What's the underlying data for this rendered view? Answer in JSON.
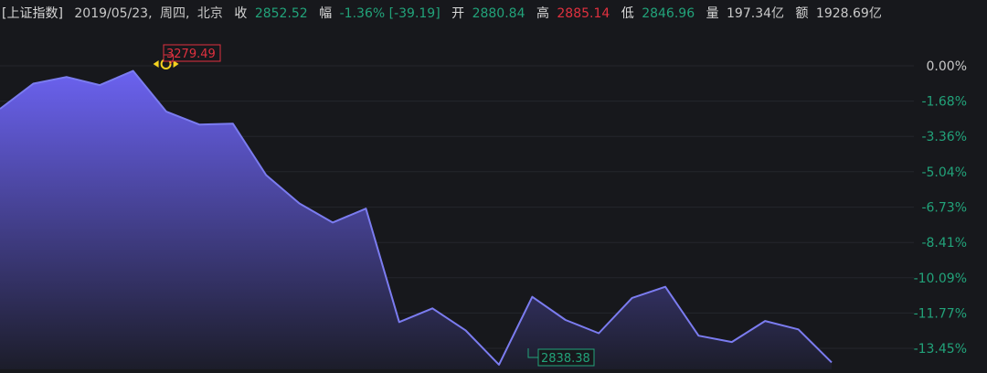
{
  "header": {
    "index_name": "[上证指数]",
    "date": "2019/05/23,",
    "weekday": "周四,",
    "region": "北京",
    "close_label": "收",
    "close_value": "2852.52",
    "change_label": "幅",
    "change_pct": "-1.36%",
    "change_abs": "[-39.19]",
    "open_label": "开",
    "open_value": "2880.84",
    "high_label": "高",
    "high_value": "2885.14",
    "low_label": "低",
    "low_value": "2846.96",
    "volume_label": "量",
    "volume_value": "197.34亿",
    "amount_label": "额",
    "amount_value": "1928.69亿"
  },
  "colors": {
    "background": "#17181c",
    "line": "#7b7cf0",
    "fill_top": "#6b62f0",
    "up": "#e0313f",
    "down": "#22a37a"
  },
  "chart_data": {
    "type": "area",
    "ylim_pct": [
      -13.45,
      0
    ],
    "y_ticks": [
      "0.00%",
      "-1.68%",
      "-3.36%",
      "-5.04%",
      "-6.73%",
      "-8.41%",
      "-10.09%",
      "-11.77%",
      "-13.45%"
    ],
    "tick_values": [
      0,
      -1.68,
      -3.36,
      -5.04,
      -6.73,
      -8.41,
      -10.09,
      -11.77,
      -13.45
    ],
    "series": [
      {
        "values_pct": [
          -2.05,
          -0.85,
          -0.53,
          -0.92,
          -0.24,
          -2.18,
          -2.8,
          -2.75,
          -5.2,
          -6.55,
          -7.46,
          -6.8,
          -12.2,
          -11.55,
          -12.6,
          -14.23,
          -11.0,
          -12.1,
          -12.73,
          -11.05,
          -10.52,
          -12.85,
          -13.15,
          -12.15,
          -12.55,
          -14.12
        ]
      }
    ],
    "annotations": {
      "max_label": "3279.49",
      "min_label": "2838.38"
    }
  }
}
